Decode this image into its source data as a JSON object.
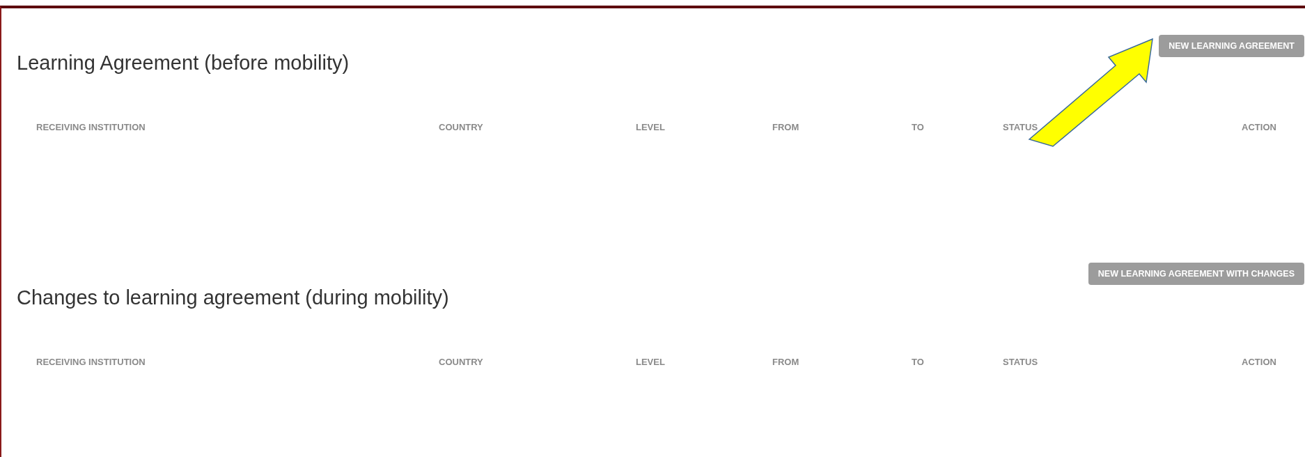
{
  "sections": [
    {
      "title": "Learning Agreement (before mobility)",
      "button": "NEW LEARNING AGREEMENT",
      "columns": [
        "RECEIVING INSTITUTION",
        "COUNTRY",
        "LEVEL",
        "FROM",
        "TO",
        "STATUS",
        "ACTION"
      ]
    },
    {
      "title": "Changes to learning agreement (during mobility)",
      "button": "NEW LEARNING AGREEMENT WITH CHANGES",
      "columns": [
        "RECEIVING INSTITUTION",
        "COUNTRY",
        "LEVEL",
        "FROM",
        "TO",
        "STATUS",
        "ACTION"
      ]
    }
  ]
}
